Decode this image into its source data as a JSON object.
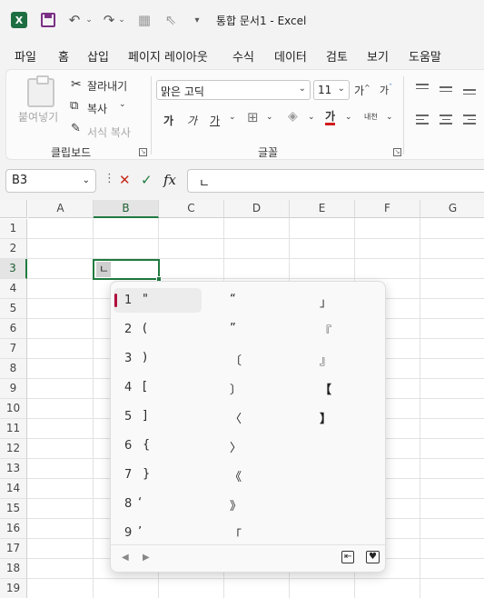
{
  "titlebar": {
    "app_logo": "X",
    "title": "통합 문서1  -  Excel",
    "icons": [
      "excel-logo",
      "save-icon",
      "undo-icon",
      "redo-icon",
      "form-icon",
      "pointer-icon",
      "customize-qat-icon"
    ]
  },
  "menu": [
    "파일",
    "홈",
    "삽입",
    "페이지 레이아웃",
    "수식",
    "데이터",
    "검토",
    "보기",
    "도움말"
  ],
  "ribbon": {
    "clipboard": {
      "paste": "붙여넣기",
      "cut": "잘라내기",
      "copy": "복사",
      "format_painter": "서식 복사",
      "group_label": "클립보드"
    },
    "font": {
      "font_name": "맑은 고딕",
      "font_size": "11",
      "increase_size": "가",
      "decrease_size": "가",
      "bold": "가",
      "italic": "가",
      "underline": "가",
      "font_color": "가",
      "phonetic": "내천",
      "group_label": "글꼴"
    }
  },
  "formula_bar": {
    "name_box": "B3",
    "fx": "fx",
    "content": "ㄴ"
  },
  "sheet": {
    "columns": [
      "A",
      "B",
      "C",
      "D",
      "E",
      "F",
      "G"
    ],
    "rows": [
      "1",
      "2",
      "3",
      "4",
      "5",
      "6",
      "7",
      "8",
      "9",
      "10",
      "11",
      "12",
      "13",
      "14",
      "15",
      "16",
      "17",
      "18",
      "19"
    ],
    "active_cell_value": "ㄴ"
  },
  "ime": {
    "candidates": [
      {
        "num": "1",
        "col1": "\"",
        "col2": "“",
        "col3": "」"
      },
      {
        "num": "2",
        "col1": "(",
        "col2": "”",
        "col3": "『"
      },
      {
        "num": "3",
        "col1": ")",
        "col2": "〔",
        "col3": "』"
      },
      {
        "num": "4",
        "col1": "[",
        "col2": "〕",
        "col3": "【"
      },
      {
        "num": "5",
        "col1": "]",
        "col2": "〈",
        "col3": "】"
      },
      {
        "num": "6",
        "col1": "{",
        "col2": "〉",
        "col3": ""
      },
      {
        "num": "7",
        "col1": "}",
        "col2": "《",
        "col3": ""
      },
      {
        "num": "8",
        "col1": "‘",
        "col2": "》",
        "col3": ""
      },
      {
        "num": "9",
        "col1": "’",
        "col2": "「",
        "col3": ""
      }
    ],
    "footer": {
      "prev": "◀",
      "next": "▶",
      "switch": "⇤",
      "favorite": "♥"
    }
  },
  "colors": {
    "accent": "#7b2f86",
    "excel_green": "#1f7a3f",
    "ime_marker": "#b0103e",
    "font_color_red": "#d01c1c"
  }
}
